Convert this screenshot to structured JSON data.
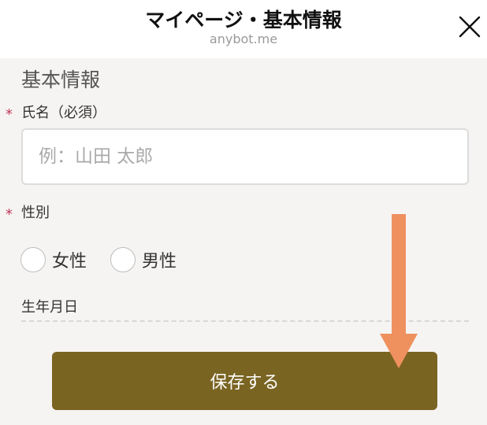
{
  "header": {
    "title": "マイページ・基本情報",
    "url": "anybot.me"
  },
  "section": {
    "title": "基本情報"
  },
  "form": {
    "required_mark": "*",
    "name": {
      "label": "氏名（必須）",
      "placeholder": "例：山田 太郎",
      "value": ""
    },
    "gender": {
      "label": "性別",
      "options": [
        "女性",
        "男性"
      ]
    },
    "dob": {
      "label": "生年月日"
    },
    "save_label": "保存する"
  },
  "colors": {
    "background": "#f6f4f2",
    "header_bg": "#ffffff",
    "required": "#c0395b",
    "button": "#7a6422",
    "arrow": "#ee915f"
  },
  "icons": {
    "close": "close-icon",
    "annotation": "down-arrow-annotation"
  }
}
